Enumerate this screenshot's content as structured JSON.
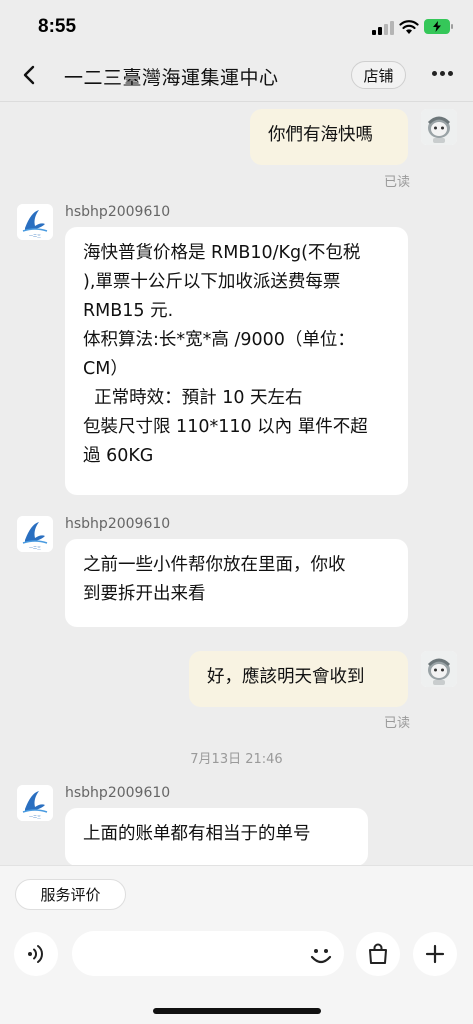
{
  "status_bar": {
    "time": "8:55",
    "icons": [
      "signal-icon",
      "wifi-icon",
      "battery-charging-icon"
    ],
    "battery_color": "#35c759"
  },
  "nav": {
    "title": "一二三臺灣海運集運中心",
    "store_label": "店铺",
    "icons": [
      "back-icon",
      "more-icon"
    ]
  },
  "messages": [
    {
      "from": "me",
      "text": "你們有海快嗎",
      "read_status": "已读"
    },
    {
      "from": "shop",
      "sender": "hsbhp2009610",
      "text": "海快普貨价格是 RMB10/Kg(不包税),單票十公斤以下加收派送费每票RMB15元.\n体积算法:长*宽*高 /9000（单位：CM）\n  正常時效：預計 10 天左右\n包裝尺寸限 110*110 以內 單件不超過 60KG"
    },
    {
      "from": "shop",
      "sender": "hsbhp2009610",
      "text": "之前一些小件帮你放在里面，你收到要拆开出来看"
    },
    {
      "from": "me",
      "text": "好，應該明天會收到",
      "read_status": "已读"
    },
    {
      "type": "timestamp",
      "text": "7月13日 21:46"
    },
    {
      "from": "shop",
      "sender": "hsbhp2009610",
      "text": "上面的账单都有相当于的单号"
    }
  ],
  "msg_lines": {
    "m2": [
      "海快普貨价格是 RMB10/Kg(不包税",
      "),單票十公斤以下加收派送费每票",
      "RMB15 元.",
      "体积算法:长*宽*高 /9000（单位：",
      "CM）",
      "  正常時效：預計 10 天左右",
      "包裝尺寸限 110*110 以內 單件不超",
      "過 60KG"
    ],
    "m3": [
      "之前一些小件帮你放在里面，你收",
      "到要拆开出来看"
    ]
  },
  "input_area": {
    "review_label": "服务评价",
    "placeholder": "",
    "icons": [
      "voice-icon",
      "emoji-icon",
      "shopping-bag-icon",
      "plus-icon"
    ]
  },
  "colors": {
    "background": "#ededed",
    "my_bubble": "#f8f3e2",
    "their_bubble": "#ffffff"
  }
}
